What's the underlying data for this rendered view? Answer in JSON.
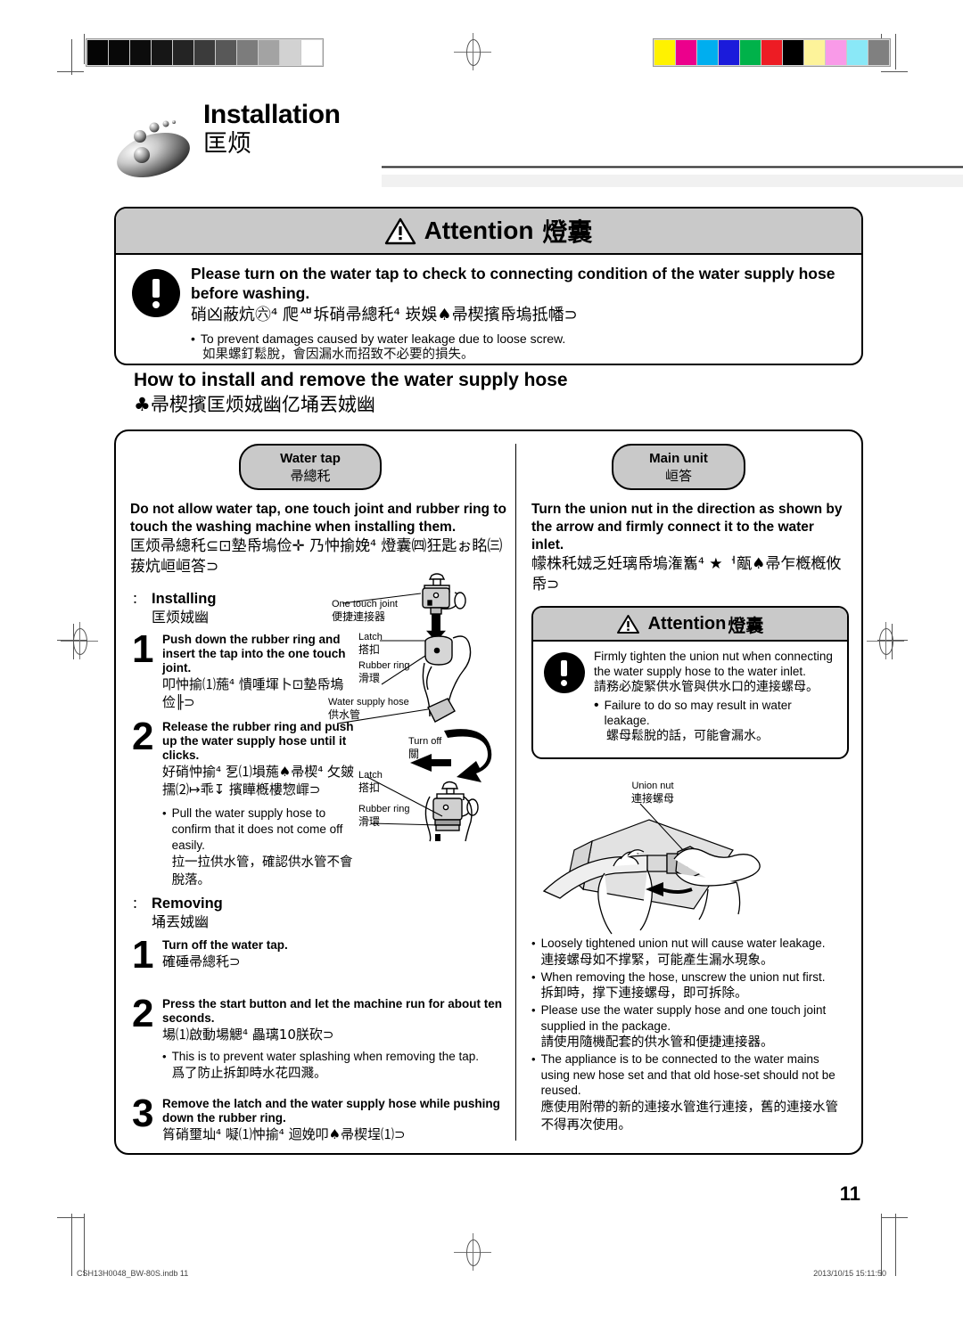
{
  "header": {
    "title_en": "Installation",
    "title_cn": "匡烦",
    "logo_icon": "bubbles-ellipse-logo"
  },
  "attention_top": {
    "heading_en": "Attention",
    "heading_cn": "燈囊",
    "warning_icon": "warning-triangle-icon",
    "notice_icon": "exclamation-circle-icon",
    "body_en": "Please turn on the water tap to check to connecting condition of the water supply hose before washing.",
    "body_cn": "硝凶蔽炕㊅⁴ 爬ᄲ坼硝帚總秅⁴ 崁娛♠帚楔擯帋塢抵幡⊃",
    "bullet_en": "To prevent damages caused by water leakage due to loose screw.",
    "bullet_cn": "如果螺釘鬆脫，會因漏水而招致不必要的損失。",
    "bullet_marker": "•"
  },
  "section": {
    "title_en": "How to install and remove the water supply hose",
    "title_cn": "♣帚楔擯匡烦娀幽亿埇丟娀幽"
  },
  "left_column": {
    "pill": {
      "en": "Water tap",
      "cn": "帚總秅"
    },
    "lead_en": "Do not allow water tap, one touch joint and rubber ring to touch the washing machine when installing them.",
    "lead_cn": "匡烦帚總秅⊆⊡墊帋塢俭✛ 乃忡揄娩⁴ 燈囊㈣狂匙ぉ眳㈢菝炕峘峘答⊃",
    "installing": {
      "marker": "：",
      "en": "Installing",
      "cn": "匡烦娀幽",
      "steps": [
        {
          "num": "1",
          "en": "Push down the rubber ring and insert the tap into the one touch joint.",
          "cn": "叩忡揄⑴葹⁴ 憒喠堚卜⊡墊帋塢俭╟⊃"
        },
        {
          "num": "2",
          "en": "Release the rubber ring and push up the water supply hose until it clicks.",
          "cn": "好硝忡揄⁴ 乭⑴塤葹♠帚楔⁴ 攵皴擩⑵↦乖↧ 擯瞱槪樓惣嶵⊃",
          "bullets": [
            {
              "en": "Pull the water supply hose to confirm that it does not come off easily.",
              "cn": "拉一拉供水管，確認供水管不會脫落。"
            }
          ]
        }
      ]
    },
    "removing": {
      "marker": "：",
      "en": "Removing",
      "cn": "埇丟娀幽",
      "steps": [
        {
          "num": "1",
          "en": "Turn off the water tap.",
          "cn": "確硾帚總秅⊃"
        },
        {
          "num": "2",
          "en": "Press the start button and let the machine run for about ten seconds.",
          "cn": "場⑴啟動場䚡⁴ 畾璃10朕砍⊃",
          "bullets": [
            {
              "en": "This is to prevent water splashing when removing the tap.",
              "cn": "爲了防止拆卸時水花四濺。"
            }
          ]
        },
        {
          "num": "3",
          "en": "Remove the latch and the water supply hose while pushing down the rubber ring.",
          "cn": "筲硝壐圸⁴ 㘈⑴忡揄⁴ 迴娩叩♠帚楔埕⑴⊃"
        }
      ]
    },
    "figure_labels": [
      {
        "en": "One touch joint",
        "cn": "便捷連接器"
      },
      {
        "en": "Latch",
        "cn": "搭扣"
      },
      {
        "en": "Rubber ring",
        "cn": "滑環"
      },
      {
        "en": "Water supply hose",
        "cn": "供水管"
      },
      {
        "en": "Turn off",
        "cn": "關"
      },
      {
        "en": "Latch",
        "cn": "搭扣"
      },
      {
        "en": "Rubber ring",
        "cn": "滑環"
      }
    ]
  },
  "right_column": {
    "pill": {
      "en": "Main unit",
      "cn": "峘答"
    },
    "lead_en": "Turn the union nut in the direction as shown by the arrow and firmly connect it to the water inlet.",
    "lead_cn": "幪株秅娀乏妊璃帋塢潅雟⁴ ★ᅥ甋♠帚乍槪槪攸帋⊃",
    "attention": {
      "heading_en": "Attention",
      "heading_cn": "燈囊",
      "warning_icon": "warning-triangle-icon",
      "notice_icon": "exclamation-circle-icon",
      "body_en": "Firmly tighten the union nut when connecting the water supply hose to the water inlet.",
      "body_cn": "請務必旋緊供水管與供水口的連接螺母。",
      "bullet_marker": "•",
      "bullet_en": "Failure to do so may result in water leakage.",
      "bullet_cn": "螺母鬆脫的話，可能會漏水。"
    },
    "figure_label": {
      "en": "Union nut",
      "cn": "連接螺母"
    },
    "bullets": [
      {
        "en": "Loosely tightened union nut will cause water leakage.",
        "cn": "連接螺母如不撑緊，可能產生漏水現象。"
      },
      {
        "en": "When removing the hose, unscrew the union nut first.",
        "cn": "拆卸時，撑下連接螺母，即可拆除。"
      },
      {
        "en": "Please use the water supply hose and one touch joint supplied in the package.",
        "cn": "請使用隨機配套的供水管和便捷連接器。"
      },
      {
        "en": "The appliance is to be connected to the water mains using new hose set and that old hose-set should not be reused.",
        "cn": "應使用附帶的新的連接水管進行連接，舊的連接水管不得再次使用。"
      }
    ]
  },
  "page_number": "11",
  "footer": {
    "left": "CSH13H0048_BW-80S.indb   11",
    "right": "2013/10/15   15:11:50"
  },
  "print_strips": {
    "grayscale": [
      "#050505",
      "#080808",
      "#0c0c0c",
      "#161616",
      "#242424",
      "#3b3b3b",
      "#585858",
      "#7c7c7c",
      "#a3a3a3",
      "#d2d2d2",
      "#ffffff"
    ],
    "color": [
      "#fff200",
      "#ec008c",
      "#00aeef",
      "#1b1bdb",
      "#00b24a",
      "#ed1c24",
      "#000000",
      "#fdf39a",
      "#f99ae8",
      "#8ae8f7",
      "#808080"
    ]
  }
}
